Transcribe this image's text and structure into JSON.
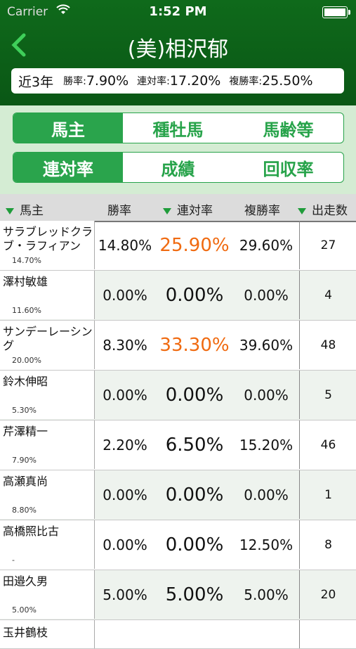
{
  "status_bar": {
    "carrier": "Carrier",
    "time": "1:52 PM"
  },
  "header": {
    "title": "(美)相沢郁",
    "back_icon": "chevron-left-icon"
  },
  "stats": {
    "period": "近3年",
    "win_label": "勝率:",
    "win_value": "7.90%",
    "place_label": "連対率:",
    "place_value": "17.20%",
    "show_label": "複勝率:",
    "show_value": "25.50%"
  },
  "segment1": {
    "items": [
      "馬主",
      "種牡馬",
      "馬齢等"
    ],
    "selected": 0
  },
  "segment2": {
    "items": [
      "連対率",
      "成績",
      "回収率"
    ],
    "selected": 0
  },
  "table": {
    "headers": [
      "馬主",
      "勝率",
      "連対率",
      "複勝率",
      "出走数"
    ],
    "rows": [
      {
        "name": "サラブレッドクラブ・ラフィアン",
        "sub": "14.70%",
        "win": "14.80%",
        "ren": "25.90%",
        "fuku": "29.60%",
        "runs": "27",
        "highlight": true
      },
      {
        "name": "澤村敏雄",
        "sub": "11.60%",
        "win": "0.00%",
        "ren": "0.00%",
        "fuku": "0.00%",
        "runs": "4",
        "highlight": false
      },
      {
        "name": "サンデーレーシング",
        "sub": "20.00%",
        "win": "8.30%",
        "ren": "33.30%",
        "fuku": "39.60%",
        "runs": "48",
        "highlight": true
      },
      {
        "name": "鈴木伸昭",
        "sub": "5.30%",
        "win": "0.00%",
        "ren": "0.00%",
        "fuku": "0.00%",
        "runs": "5",
        "highlight": false
      },
      {
        "name": "芹澤精一",
        "sub": "7.90%",
        "win": "2.20%",
        "ren": "6.50%",
        "fuku": "15.20%",
        "runs": "46",
        "highlight": false
      },
      {
        "name": "高瀬真尚",
        "sub": "8.80%",
        "win": "0.00%",
        "ren": "0.00%",
        "fuku": "0.00%",
        "runs": "1",
        "highlight": false
      },
      {
        "name": "高橋照比古",
        "sub": "-",
        "win": "0.00%",
        "ren": "0.00%",
        "fuku": "12.50%",
        "runs": "8",
        "highlight": false
      },
      {
        "name": "田邉久男",
        "sub": "5.00%",
        "win": "5.00%",
        "ren": "5.00%",
        "fuku": "5.00%",
        "runs": "20",
        "highlight": false
      }
    ],
    "partial_row": {
      "name": "玉井鶴枝"
    }
  },
  "colors": {
    "header_green": "#0f6a1b",
    "accent_green": "#2aa44c",
    "highlight_orange": "#f06a10"
  }
}
